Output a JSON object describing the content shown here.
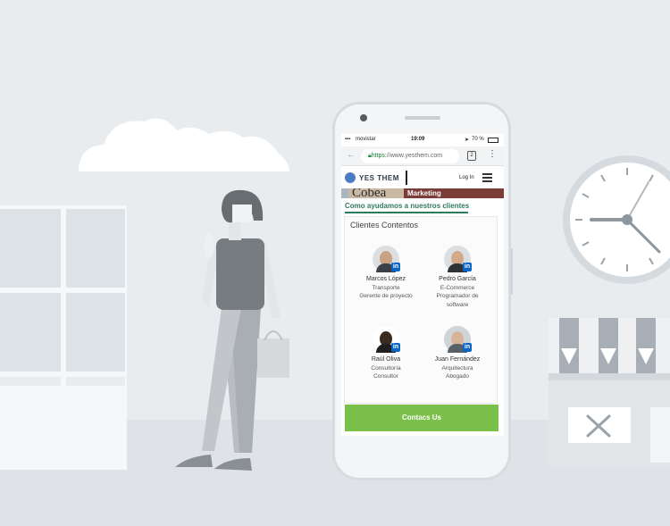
{
  "statusbar": {
    "carrier": "movistar",
    "time": "19:09",
    "battery": "70 %"
  },
  "browser": {
    "url_scheme": "https",
    "url_rest": "://www.yesthem.com",
    "tab_count": "2"
  },
  "site": {
    "logo_text": "YES THEM",
    "login_label": "Log In",
    "banner_logo": "Cobea",
    "banner_tag": "Marketing",
    "headline": "Como ayudamos a nuestros clientes"
  },
  "clients_section": {
    "title": "Clientes Contentos",
    "clients": [
      {
        "name": "Marcos López",
        "line1": "Transporte",
        "line2": "Gerente de proyecto",
        "line3": ""
      },
      {
        "name": "Pedro García",
        "line1": "E-Commerce",
        "line2": "Programador de",
        "line3": "software"
      },
      {
        "name": "Raúl Oliva",
        "line1": "Consultoría",
        "line2": "Consultor",
        "line3": ""
      },
      {
        "name": "Juan Fernández",
        "line1": "Arquitectura",
        "line2": "Abogado",
        "line3": ""
      }
    ],
    "badge_letters": "in"
  },
  "cta": {
    "label": "Contacs Us"
  },
  "colors": {
    "accent_green": "#7bc04a",
    "headline_green": "#2f7a5b",
    "linkedin_blue": "#0a66c2",
    "background": "#e9ecef"
  }
}
